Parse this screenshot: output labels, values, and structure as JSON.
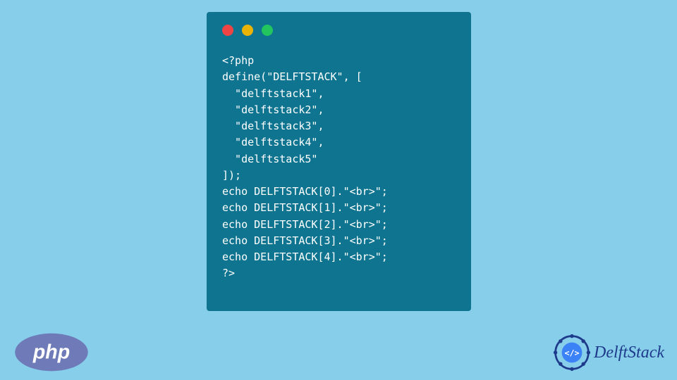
{
  "code": {
    "lines": [
      "<?php",
      "define(\"DELFTSTACK\", [",
      "  \"delftstack1\",",
      "  \"delftstack2\",",
      "  \"delftstack3\",",
      "  \"delftstack4\",",
      "  \"delftstack5\"",
      "]);",
      "echo DELFTSTACK[0].\"<br>\";",
      "echo DELFTSTACK[1].\"<br>\";",
      "echo DELFTSTACK[2].\"<br>\";",
      "echo DELFTSTACK[3].\"<br>\";",
      "echo DELFTSTACK[4].\"<br>\";",
      "?>"
    ]
  },
  "logos": {
    "php_text": "php",
    "delftstack_text": "DelftStack"
  }
}
